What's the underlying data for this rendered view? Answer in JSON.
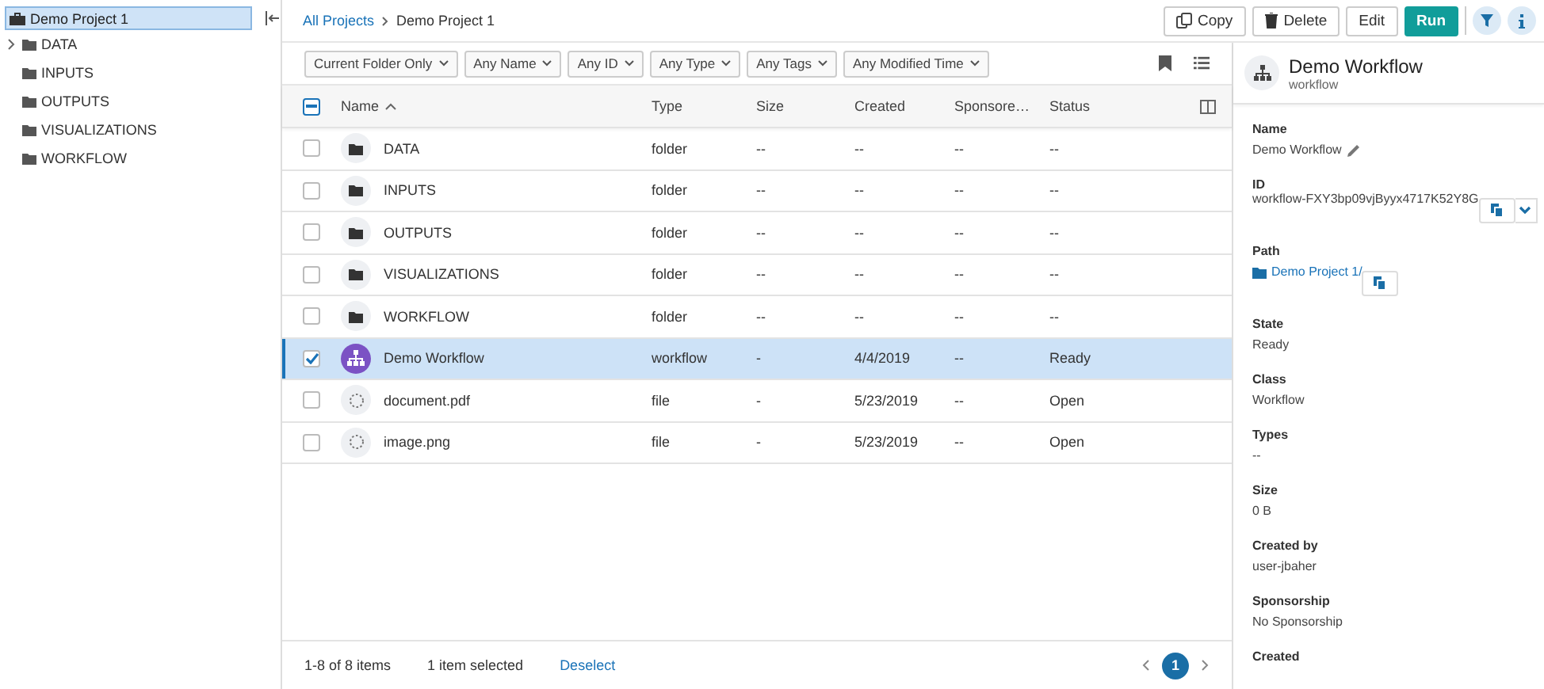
{
  "sidebar": {
    "root": {
      "label": "Demo Project 1",
      "selected": true
    },
    "children": [
      {
        "label": "DATA",
        "expandable": true
      },
      {
        "label": "INPUTS",
        "expandable": false
      },
      {
        "label": "OUTPUTS",
        "expandable": false
      },
      {
        "label": "VISUALIZATIONS",
        "expandable": false
      },
      {
        "label": "WORKFLOW",
        "expandable": false
      }
    ]
  },
  "breadcrumb": [
    {
      "label": "All Projects",
      "kind": "link"
    },
    {
      "label": "Demo Project 1",
      "kind": "current"
    }
  ],
  "toolbar": {
    "buttons": [
      {
        "label": "Copy",
        "kind": "copy"
      },
      {
        "label": "Delete",
        "kind": "delete"
      },
      {
        "label": "Edit",
        "kind": "plain"
      },
      {
        "label": "Run",
        "kind": "primary"
      }
    ],
    "filter_on": true,
    "info_on": true
  },
  "filters": [
    "Current Folder Only",
    "Any Name",
    "Any ID",
    "Any Type",
    "Any Tags",
    "Any Modified Time"
  ],
  "table": {
    "select_all": {
      "indeterminate": true
    },
    "columns": [
      {
        "label": "Name",
        "sorted": true
      },
      {
        "label": "Type",
        "sorted": false
      },
      {
        "label": "Size",
        "sorted": false
      },
      {
        "label": "Created",
        "sorted": false
      },
      {
        "label": "Sponsore…",
        "sorted": false
      },
      {
        "label": "Status",
        "sorted": false
      }
    ],
    "rows": [
      {
        "kind": "folder",
        "selected": false,
        "cells": [
          "DATA",
          "folder",
          "--",
          "--",
          "--",
          "--"
        ]
      },
      {
        "kind": "folder",
        "selected": false,
        "cells": [
          "INPUTS",
          "folder",
          "--",
          "--",
          "--",
          "--"
        ]
      },
      {
        "kind": "folder",
        "selected": false,
        "cells": [
          "OUTPUTS",
          "folder",
          "--",
          "--",
          "--",
          "--"
        ]
      },
      {
        "kind": "folder",
        "selected": false,
        "cells": [
          "VISUALIZATIONS",
          "folder",
          "--",
          "--",
          "--",
          "--"
        ]
      },
      {
        "kind": "folder",
        "selected": false,
        "cells": [
          "WORKFLOW",
          "folder",
          "--",
          "--",
          "--",
          "--"
        ]
      },
      {
        "kind": "workflow",
        "selected": true,
        "cells": [
          "Demo Workflow",
          "workflow",
          "-",
          "4/4/2019",
          "--",
          "Ready"
        ]
      },
      {
        "kind": "file",
        "selected": false,
        "cells": [
          "document.pdf",
          "file",
          "-",
          "5/23/2019",
          "--",
          "Open"
        ]
      },
      {
        "kind": "file",
        "selected": false,
        "cells": [
          "image.png",
          "file",
          "-",
          "5/23/2019",
          "--",
          "Open"
        ]
      }
    ]
  },
  "footer": {
    "range": "1-8 of 8 items",
    "selection": "1 item selected",
    "deselect": "Deselect",
    "pages": [
      {
        "label": "1",
        "selected": true
      }
    ]
  },
  "details": {
    "title": "Demo Workflow",
    "subtitle": "workflow",
    "fields": [
      {
        "label": "Name",
        "value": "Demo Workflow",
        "kind": "editable"
      },
      {
        "label": "ID",
        "value": "workflow-FXY3bp09vjByyx4717K52Y8G",
        "kind": "id"
      },
      {
        "label": "Path",
        "value": "Demo Project 1/",
        "kind": "path"
      },
      {
        "label": "State",
        "value": "Ready",
        "kind": "text"
      },
      {
        "label": "Class",
        "value": "Workflow",
        "kind": "text"
      },
      {
        "label": "Types",
        "value": "--",
        "kind": "text"
      },
      {
        "label": "Size",
        "value": "0 B",
        "kind": "text"
      },
      {
        "label": "Created by",
        "value": "user-jbaher",
        "kind": "text"
      },
      {
        "label": "Sponsorship",
        "value": "No Sponsorship",
        "kind": "text"
      },
      {
        "label": "Created",
        "kind": "label_only"
      }
    ]
  }
}
